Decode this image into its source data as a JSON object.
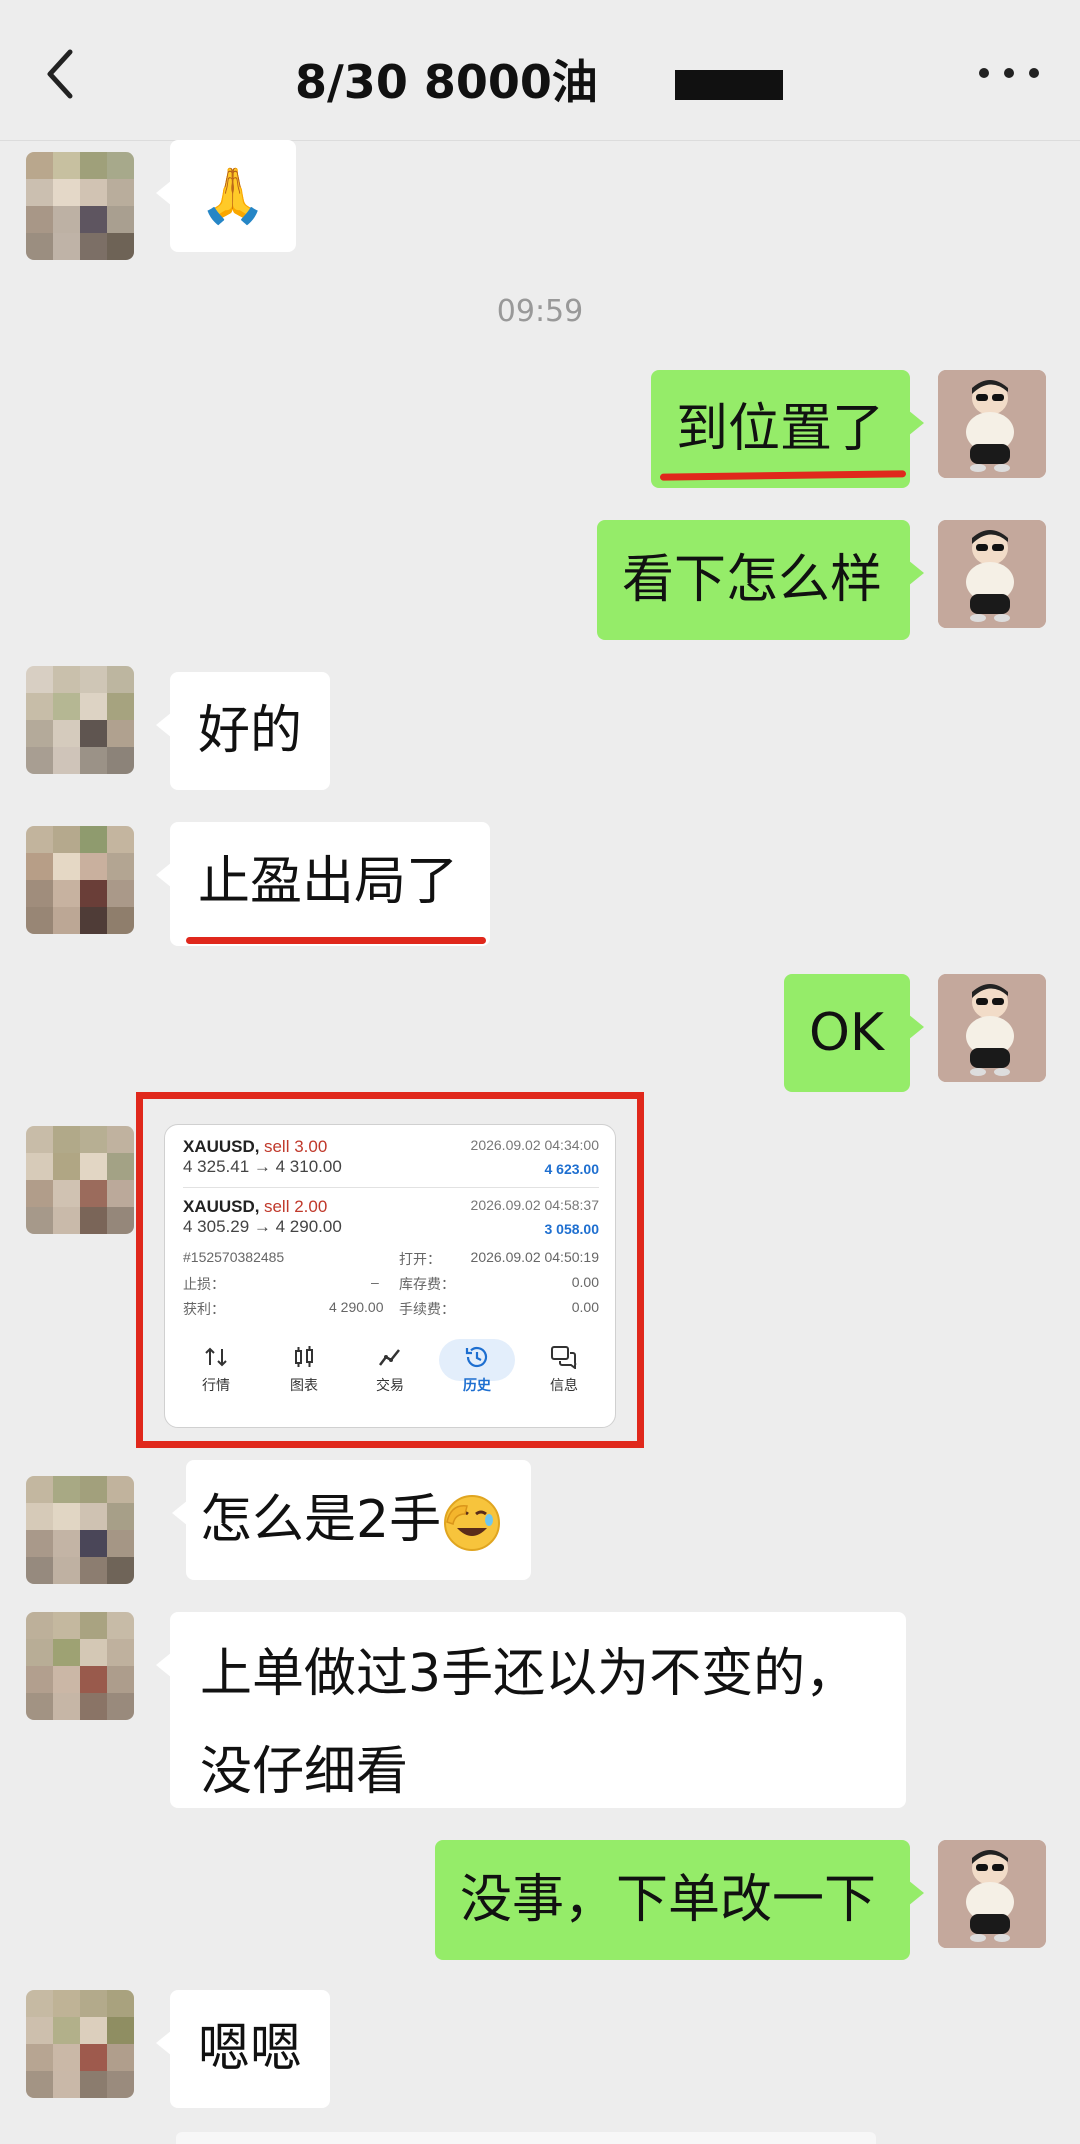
{
  "header": {
    "title": "8/30  8000油",
    "back_icon": "back-chevron-icon",
    "more_icon": "more-dots-icon"
  },
  "timestamp": "09:59",
  "messages": [
    {
      "side": "left",
      "text": "🙏"
    },
    {
      "side": "right",
      "text": "到位置了"
    },
    {
      "side": "right",
      "text": "看下怎么样"
    },
    {
      "side": "left",
      "text": "好的"
    },
    {
      "side": "left",
      "text": "止盈出局了"
    },
    {
      "side": "right",
      "text": "OK"
    },
    {
      "side": "left",
      "text": "怎么是2手"
    },
    {
      "side": "left",
      "text": "上单做过3手还以为不变的，"
    },
    {
      "side": "left",
      "text": "没仔细看"
    },
    {
      "side": "right",
      "text": "没事，下单改一下"
    },
    {
      "side": "left",
      "text": "嗯嗯"
    }
  ],
  "trade_card": {
    "trade1": {
      "symbol": "XAUUSD,",
      "action": "sell 3.00",
      "prices": "4 325.41 → 4 310.00",
      "time": "2026.09.02 04:34:00",
      "profit": "4 623.00"
    },
    "trade2": {
      "symbol": "XAUUSD,",
      "action": "sell 2.00",
      "prices": "4 305.29 → 4 290.00",
      "time": "2026.09.02 04:58:37",
      "profit": "3 058.00"
    },
    "ticket": "#152570382485",
    "open_label": "打开：",
    "open_time": "2026.09.02 04:50:19",
    "sl_label": "止损：",
    "sl_value": "–",
    "swap_label": "库存费：",
    "swap_value": "0.00",
    "tp_label": "获利：",
    "tp_value": "4 290.00",
    "commission_label": "手续费：",
    "commission_value": "0.00",
    "tabs": [
      "行情",
      "图表",
      "交易",
      "历史",
      "信息"
    ],
    "active_tab": "历史",
    "accent_color": "#1e6fd0"
  },
  "colors": {
    "sent_bubble": "#95ec69",
    "received_bubble": "#ffffff",
    "background": "#ededed",
    "highlight_red": "#e0281c"
  }
}
